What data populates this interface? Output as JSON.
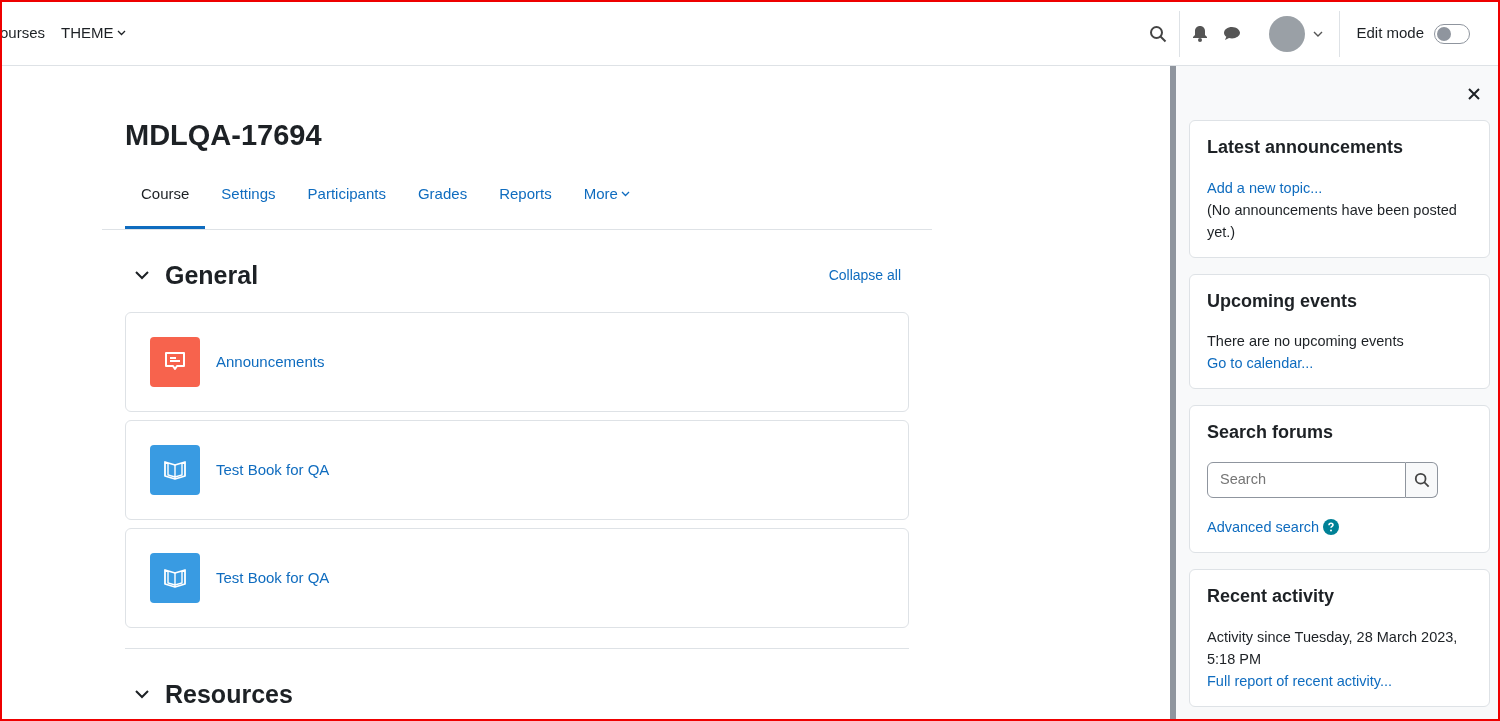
{
  "navbar": {
    "menu": [
      {
        "label": "ourses",
        "dropdown": false
      },
      {
        "label": "THEME",
        "dropdown": true
      }
    ],
    "edit_mode": {
      "label": "Edit mode",
      "on": false
    }
  },
  "course": {
    "title": "MDLQA-17694",
    "tabs": [
      {
        "label": "Course",
        "selected": true,
        "dropdown": false
      },
      {
        "label": "Settings",
        "selected": false,
        "dropdown": false
      },
      {
        "label": "Participants",
        "selected": false,
        "dropdown": false
      },
      {
        "label": "Grades",
        "selected": false,
        "dropdown": false
      },
      {
        "label": "Reports",
        "selected": false,
        "dropdown": false
      },
      {
        "label": "More",
        "selected": false,
        "dropdown": true
      }
    ],
    "collapse_all": "Collapse all",
    "sections": [
      {
        "title": "General",
        "expanded": true,
        "activities": [
          {
            "kind": "forum",
            "name": "Announcements"
          },
          {
            "kind": "book",
            "name": "Test Book for QA"
          },
          {
            "kind": "book",
            "name": "Test Book for QA"
          }
        ]
      },
      {
        "title": "Resources",
        "expanded": true
      }
    ]
  },
  "drawer": {
    "blocks": [
      {
        "kind": "text",
        "title": "Latest announcements",
        "lines": [
          {
            "kind": "link",
            "text": "Add a new topic..."
          },
          {
            "kind": "text",
            "text": "(No announcements have been posted yet.)"
          }
        ]
      },
      {
        "kind": "text",
        "title": "Upcoming events",
        "lines": [
          {
            "kind": "text",
            "text": "There are no upcoming events"
          },
          {
            "kind": "link",
            "text": "Go to calendar..."
          }
        ]
      },
      {
        "kind": "search",
        "title": "Search forums",
        "placeholder": "Search",
        "link": "Advanced search"
      },
      {
        "kind": "text",
        "title": "Recent activity",
        "lines": [
          {
            "kind": "text",
            "text": "Activity since Tuesday, 28 March 2023, 5:18 PM"
          },
          {
            "kind": "link",
            "text": "Full report of recent activity..."
          }
        ]
      }
    ]
  }
}
